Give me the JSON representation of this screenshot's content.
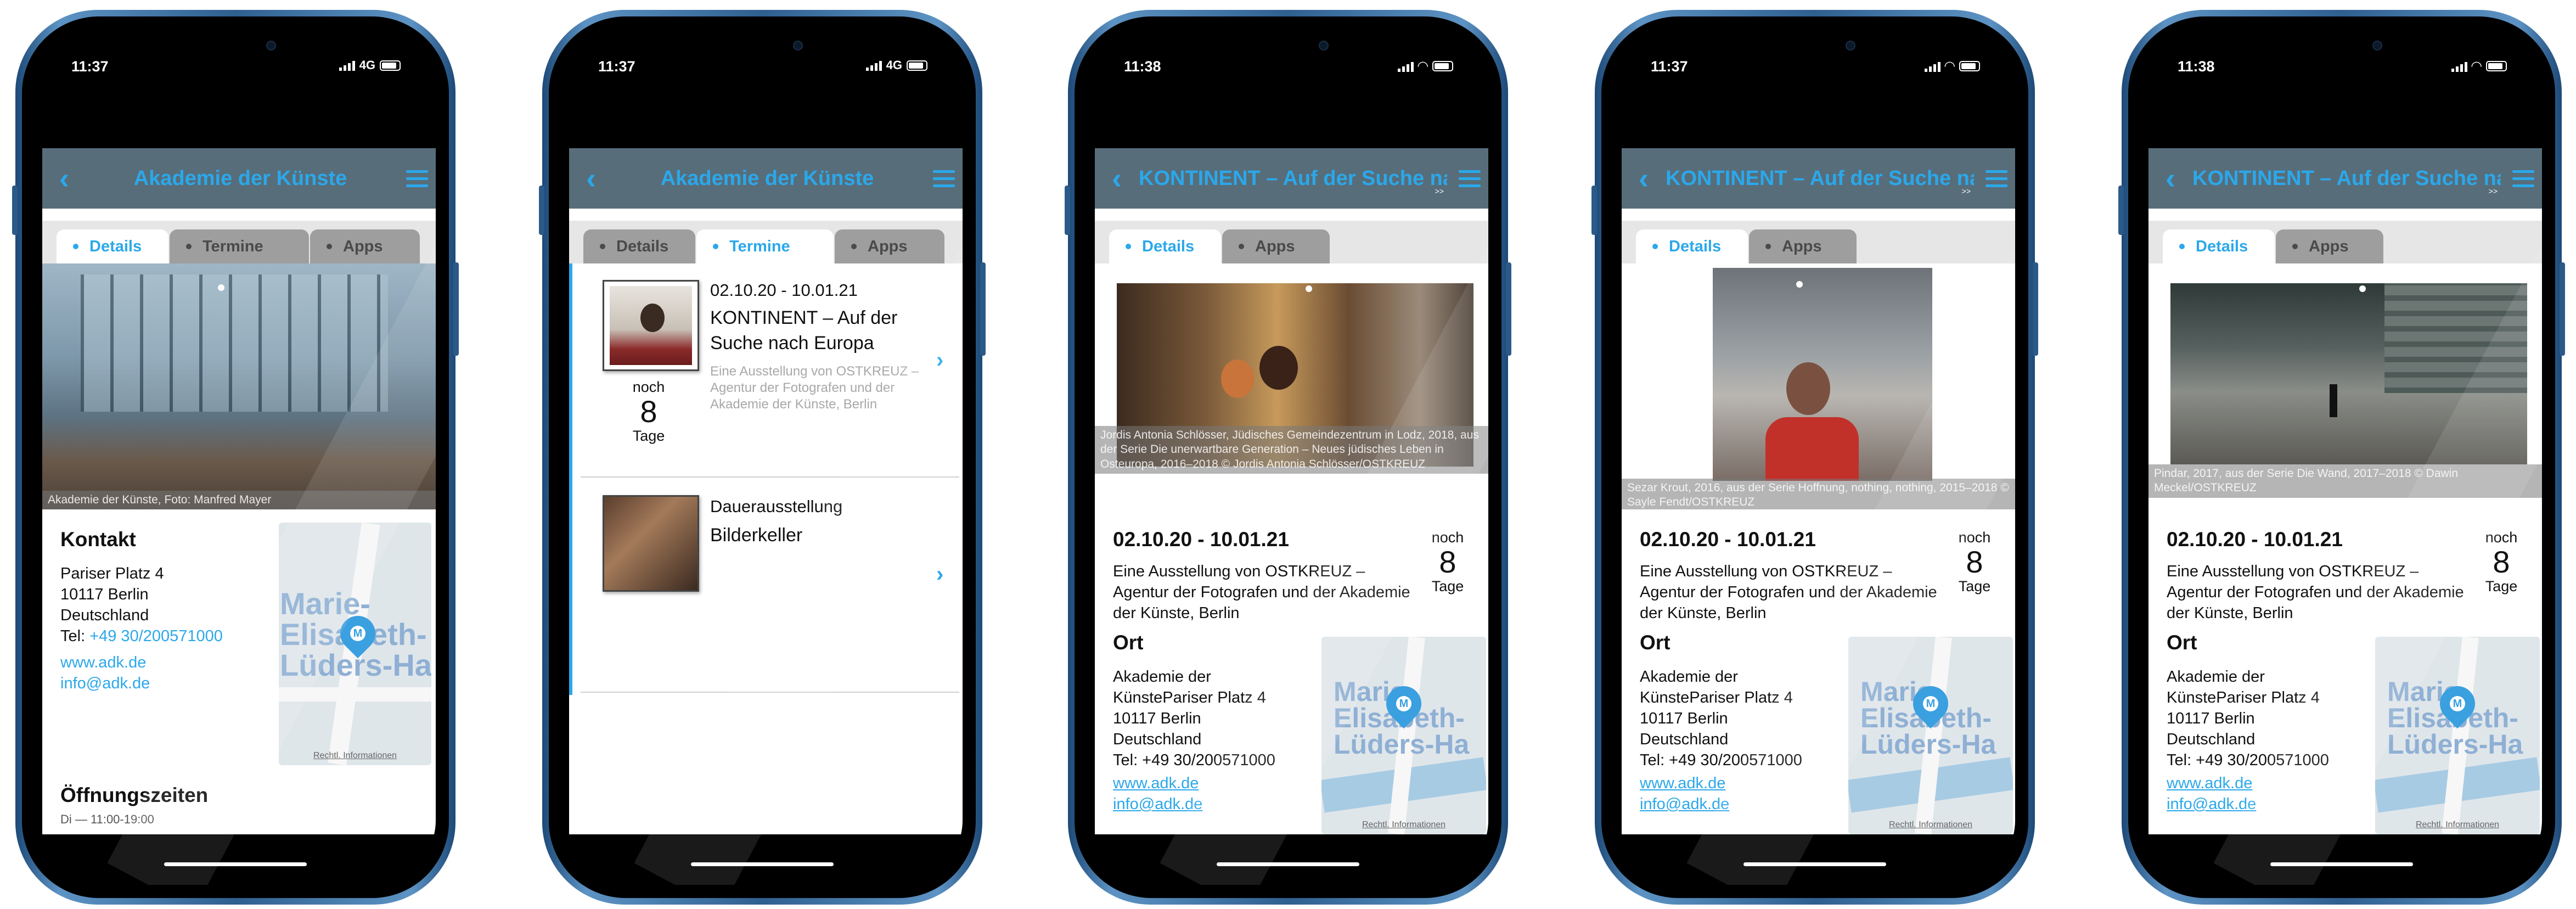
{
  "phones": [
    {
      "time": "11:37",
      "network": "4G",
      "nav": {
        "back": "‹",
        "title": "Akademie der Künste"
      },
      "tabs": [
        "Details",
        "Termine",
        "Apps"
      ],
      "photo_caption": "Akademie der Künste, Foto: Manfred Mayer",
      "kontakt": {
        "heading": "Kontakt",
        "address": [
          "Pariser Platz 4",
          "10117 Berlin",
          "Deutschland"
        ],
        "tel_label": "Tel: ",
        "tel": "+49 30/200571000",
        "web": "www.adk.de",
        "email": "info@adk.de"
      },
      "map": {
        "label": "Marie-\nElisabeth-\nLüders-Hau",
        "legal": "Rechtl. Informationen"
      },
      "oeffnung": {
        "heading": "Öffnungszeiten",
        "partial": "Di — 11:00-19:00"
      }
    },
    {
      "time": "11:37",
      "network": "4G",
      "nav": {
        "back": "‹",
        "title": "Akademie der Künste"
      },
      "tabs": [
        "Details",
        "Termine",
        "Apps"
      ],
      "events": [
        {
          "date": "02.10.20 - 10.01.21",
          "title": "KONTINENT – Auf der Suche nach Europa",
          "desc": "Eine Ausstellung von OSTKREUZ – Agentur der Fotografen und der Akademie der Künste, Berlin",
          "noch": "noch",
          "days": "8",
          "tage": "Tage"
        },
        {
          "date": "Dauerausstellung",
          "title": "Bilderkeller"
        }
      ]
    },
    {
      "time": "11:38",
      "nav": {
        "back": "‹",
        "title": "KONTINENT – Auf der Suche nach Europa",
        "more": ">>"
      },
      "tabs": [
        "Details",
        "Apps"
      ],
      "photo_caption": "Jordis Antonia Schlösser, Jüdisches Gemeindezentrum in Lodz, 2018, aus der Serie Die unerwartbare Generation – Neues jüdisches Leben in Osteuropa, 2016–2018 © Jordis Antonia Schlösser/OSTKREUZ",
      "detail": {
        "dates": "02.10.20 - 10.01.21",
        "noch": "noch",
        "days": "8",
        "tage": "Tage",
        "desc": "Eine Ausstellung von OSTKREUZ – Agentur der Fotografen und der Akademie der Künste, Berlin",
        "ort_heading": "Ort",
        "ort": [
          "Akademie der",
          "KünstePariser Platz 4",
          "10117 Berlin",
          "Deutschland",
          "Tel: +49 30/200571000"
        ],
        "web": "www.adk.de",
        "email": "info@adk.de"
      },
      "map": {
        "label": "Marie-\nElisabeth-\nLüders-Ha",
        "legal": "Rechtl. Informationen"
      }
    },
    {
      "time": "11:37",
      "nav": {
        "back": "‹",
        "title": "KONTINENT – Auf der Suche nach Europa",
        "more": ">>"
      },
      "tabs": [
        "Details",
        "Apps"
      ],
      "photo_caption": "Sezar Krout, 2016, aus der Serie Hoffnung, nothing, nothing, 2015–2018 © Sayle Fendt/OSTKREUZ",
      "detail": {
        "dates": "02.10.20 - 10.01.21",
        "noch": "noch",
        "days": "8",
        "tage": "Tage",
        "desc": "Eine Ausstellung von OSTKREUZ – Agentur der Fotografen und der Akademie der Künste, Berlin",
        "ort_heading": "Ort",
        "ort": [
          "Akademie der",
          "KünstePariser Platz 4",
          "10117 Berlin",
          "Deutschland",
          "Tel: +49 30/200571000"
        ],
        "web": "www.adk.de",
        "email": "info@adk.de"
      },
      "map": {
        "label": "Marie-\nElisabeth-\nLüders-Ha",
        "legal": "Rechtl. Informationen"
      }
    },
    {
      "time": "11:38",
      "nav": {
        "back": "‹",
        "title": "KONTINENT – Auf der Suche nach Europa",
        "more": ">>"
      },
      "tabs": [
        "Details",
        "Apps"
      ],
      "photo_caption": "Pindar, 2017, aus der Serie Die Wand, 2017–2018 © Dawin Meckel/OSTKREUZ",
      "detail": {
        "dates": "02.10.20 - 10.01.21",
        "noch": "noch",
        "days": "8",
        "tage": "Tage",
        "desc": "Eine Ausstellung von OSTKREUZ – Agentur der Fotografen und der Akademie der Künste, Berlin",
        "ort_heading": "Ort",
        "ort": [
          "Akademie der",
          "KünstePariser Platz 4",
          "10117 Berlin",
          "Deutschland",
          "Tel: +49 30/200571000"
        ],
        "web": "www.adk.de",
        "email": "info@adk.de"
      },
      "map": {
        "label": "Marie-\nElisabeth-\nLüders-Ha",
        "legal": "Rechtl. Informationen"
      }
    }
  ],
  "colors": {
    "accent": "#2ba8ea",
    "navbar": "#576d7a",
    "tab_inactive": "#9e9e9e",
    "phone_frame": "#3b6fa1"
  }
}
